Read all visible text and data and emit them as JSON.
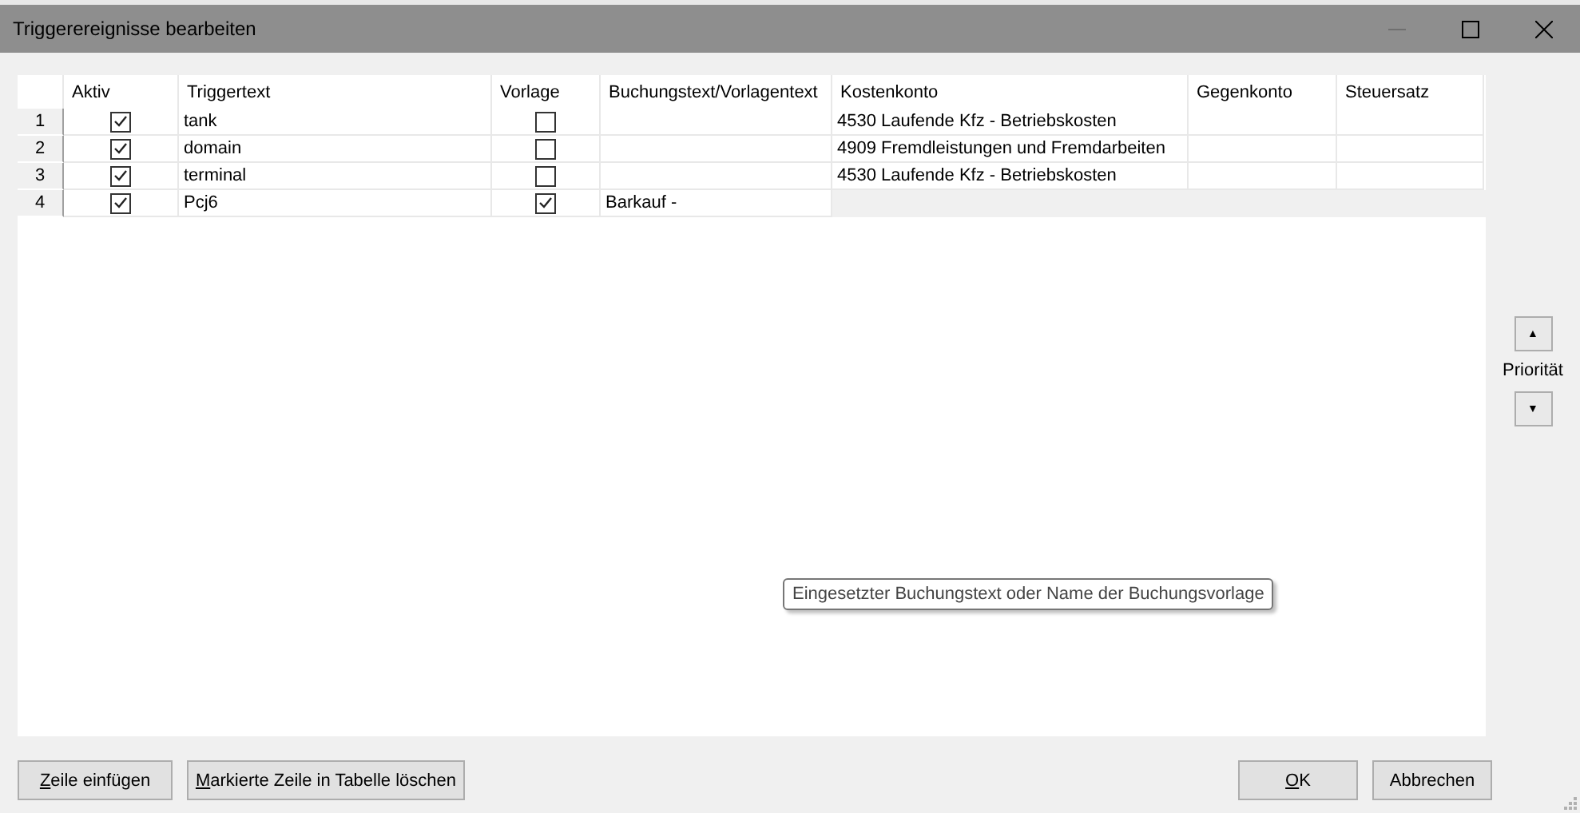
{
  "window": {
    "title": "Triggerereignisse bearbeiten"
  },
  "table": {
    "columns": [
      "Aktiv",
      "Triggertext",
      "Vorlage",
      "Buchungstext/Vorlagentext",
      "Kostenkonto",
      "Gegenkonto",
      "Steuersatz"
    ],
    "rows": [
      {
        "kind": "account",
        "number": "1",
        "aktiv": true,
        "triggertext": "tank",
        "vorlage": false,
        "kostenkonto": "4530 Laufende Kfz - Betriebskosten"
      },
      {
        "kind": "account",
        "number": "2",
        "aktiv": true,
        "triggertext": "domain",
        "vorlage": false,
        "kostenkonto": "4909 Fremdleistungen und Fremdarbeiten"
      },
      {
        "kind": "account",
        "number": "3",
        "aktiv": true,
        "triggertext": "terminal",
        "vorlage": false,
        "kostenkonto": "4530 Laufende Kfz - Betriebskosten"
      },
      {
        "kind": "template",
        "number": "4",
        "aktiv": true,
        "triggertext": "Pcj6",
        "vorlage": true,
        "buchungstext": "Barkauf -"
      }
    ]
  },
  "tooltip": "Eingesetzter Buchungstext oder Name der Buchungsvorlage",
  "priority": {
    "label": "Priorität",
    "up": "▲",
    "down": "▼"
  },
  "buttons_left": [
    {
      "label": "Zeile einfügen",
      "mnemonic_underlined": true
    },
    {
      "label": "Markierte Zeile in Tabelle löschen",
      "mnemonic_underlined": true
    }
  ],
  "buttons_right": [
    {
      "label": "OK",
      "mnemonic_underlined": true
    },
    {
      "label": "Abbrechen",
      "mnemonic_underlined": false
    }
  ]
}
